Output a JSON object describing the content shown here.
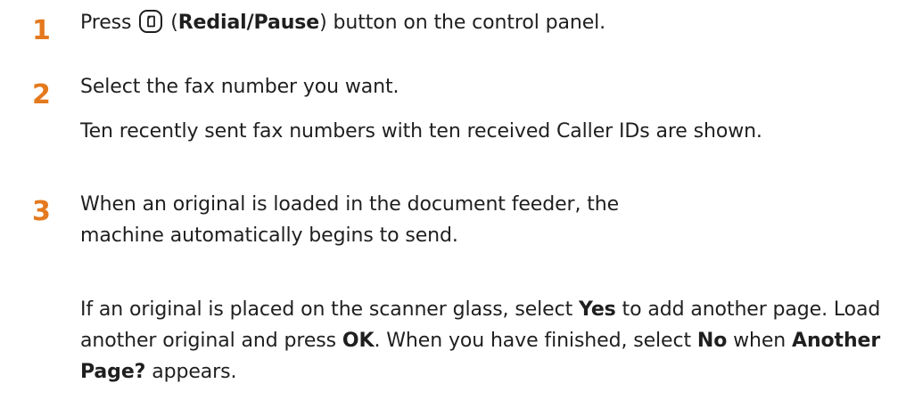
{
  "steps": [
    {
      "number": "1",
      "paragraphs": [
        {
          "pre": "Press ",
          "icon": "redial-pause-button-icon",
          "mid": " (",
          "bold": "Redial/Pause",
          "post": ") button on the control panel."
        }
      ]
    },
    {
      "number": "2",
      "paragraphs": [
        {
          "text": "Select the fax number you want."
        },
        {
          "text": "Ten recently sent fax numbers with ten received Caller IDs are shown."
        }
      ]
    },
    {
      "number": "3",
      "paragraphs": [
        {
          "text": "When an original is loaded in the document feeder, the machine automatically begins to send."
        },
        {
          "s1": "If an original is placed on the scanner glass, select ",
          "b1": "Yes",
          "s2": " to add another page. Load another original and press ",
          "b2": "OK",
          "s3": ". When you have finished, select ",
          "b3": "No",
          "s4": " when ",
          "b4": "Another Page?",
          "s5": " appears."
        }
      ]
    }
  ],
  "colors": {
    "step_number": "#e4791e",
    "body_text": "#1f1f1f"
  }
}
